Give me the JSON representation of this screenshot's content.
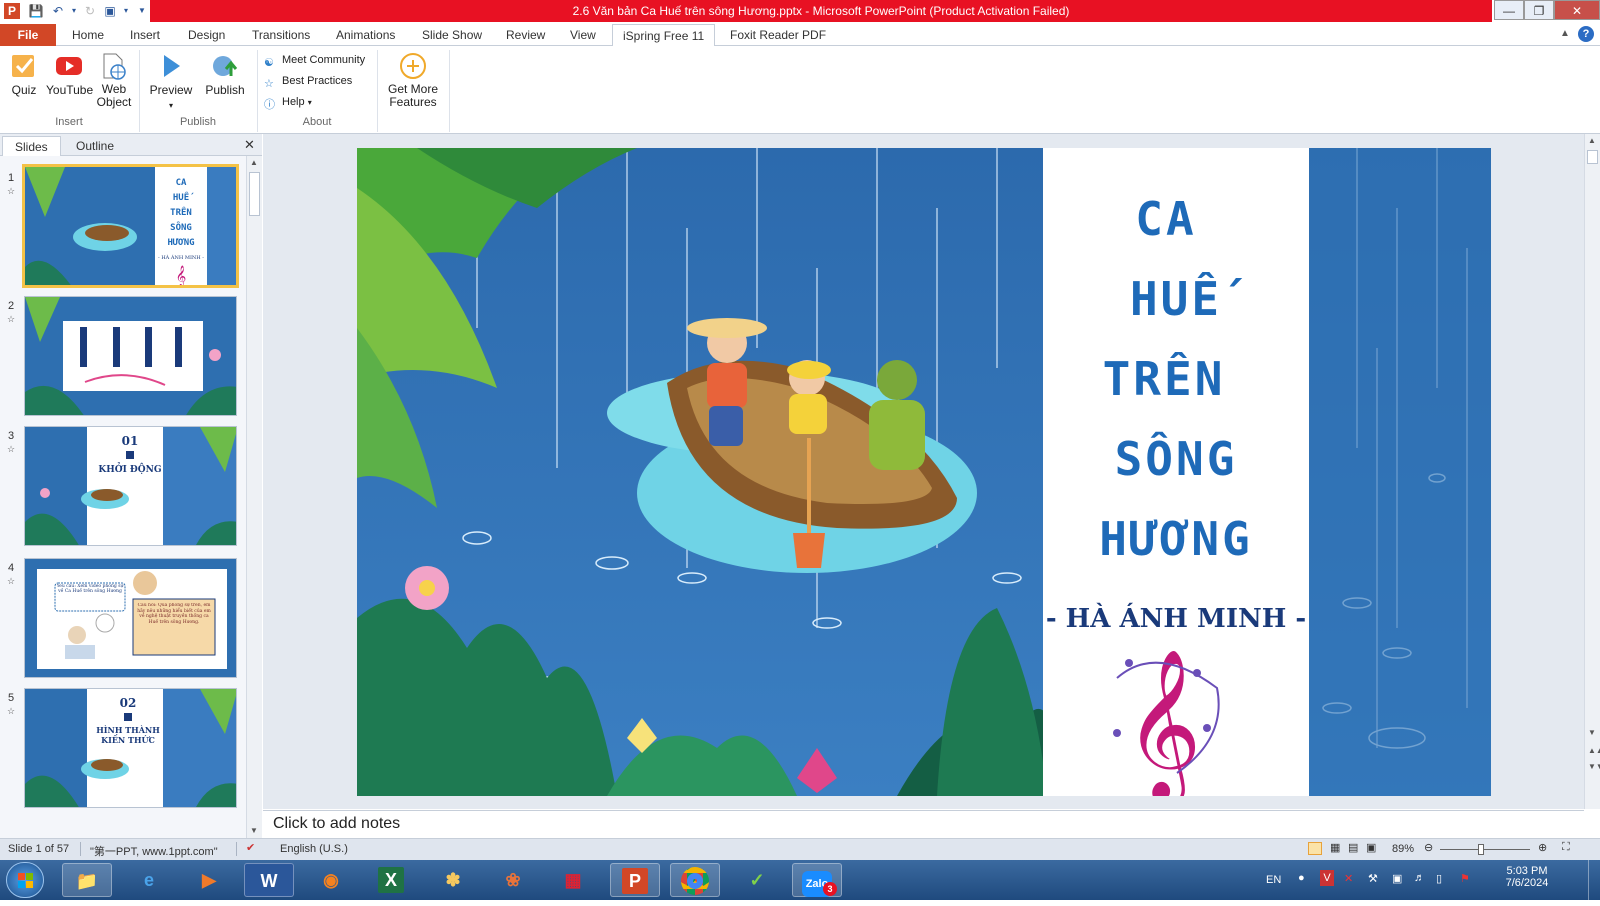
{
  "window": {
    "title": "2.6 Văn bản Ca Huế trên sông Hương.pptx - Microsoft PowerPoint (Product Activation Failed)"
  },
  "tabs": [
    "File",
    "Home",
    "Insert",
    "Design",
    "Transitions",
    "Animations",
    "Slide Show",
    "Review",
    "View",
    "iSpring Free 11",
    "Foxit Reader PDF"
  ],
  "ribbon": {
    "insert_group": {
      "label": "Insert",
      "quiz": "Quiz",
      "youtube": "YouTube",
      "web_object_1": "Web",
      "web_object_2": "Object"
    },
    "publish_group": {
      "label": "Publish",
      "preview": "Preview",
      "publish": "Publish"
    },
    "about_group": {
      "label": "About",
      "meet_community": "Meet Community",
      "best_practices": "Best Practices",
      "help": "Help"
    },
    "more": {
      "line1": "Get More",
      "line2": "Features"
    }
  },
  "panel": {
    "tab_slides": "Slides",
    "tab_outline": "Outline"
  },
  "thumbnails": {
    "s1": {
      "num": "1",
      "title_lines": [
        "CA",
        "HUẾ",
        "TRÊN",
        "SÔNG",
        "HƯƠNG"
      ],
      "author": "- HÀ ÁNH MINH -"
    },
    "s2": {
      "num": "2"
    },
    "s3": {
      "num": "3",
      "number": "01",
      "heading": "KHỞI ĐỘNG"
    },
    "s4": {
      "num": "4",
      "left_text": "Yêu cầu: Xem video phóng sự về Ca Huế trên sông Hương",
      "right_text": "Câu hỏi: Qua phóng sự trên, em hãy nêu những hiểu biết của em về nghệ thuật truyền thống ca Huế trên sông Hương."
    },
    "s5": {
      "num": "5",
      "number": "02",
      "heading_1": "HÌNH THÀNH",
      "heading_2": "KIẾN THỨC"
    }
  },
  "slide": {
    "title_lines": [
      "CA",
      "HUẾ",
      "TRÊN",
      "SÔNG",
      "HƯƠNG"
    ],
    "author": "- HÀ ÁNH MINH -"
  },
  "notes": {
    "placeholder": "Click to add notes"
  },
  "status": {
    "slide_info": "Slide 1 of 57",
    "theme": "\"第一PPT, www.1ppt.com\"",
    "language": "English (U.S.)",
    "zoom": "89%"
  },
  "taskbar": {
    "lang": "EN",
    "time": "5:03 PM",
    "date": "7/6/2024",
    "zalo_badge": "3"
  },
  "colors": {
    "file_tab": "#d24726",
    "title_bar": "#e81123",
    "slide_title": "#1e6ab8",
    "slide_author": "#1a3a7a"
  }
}
